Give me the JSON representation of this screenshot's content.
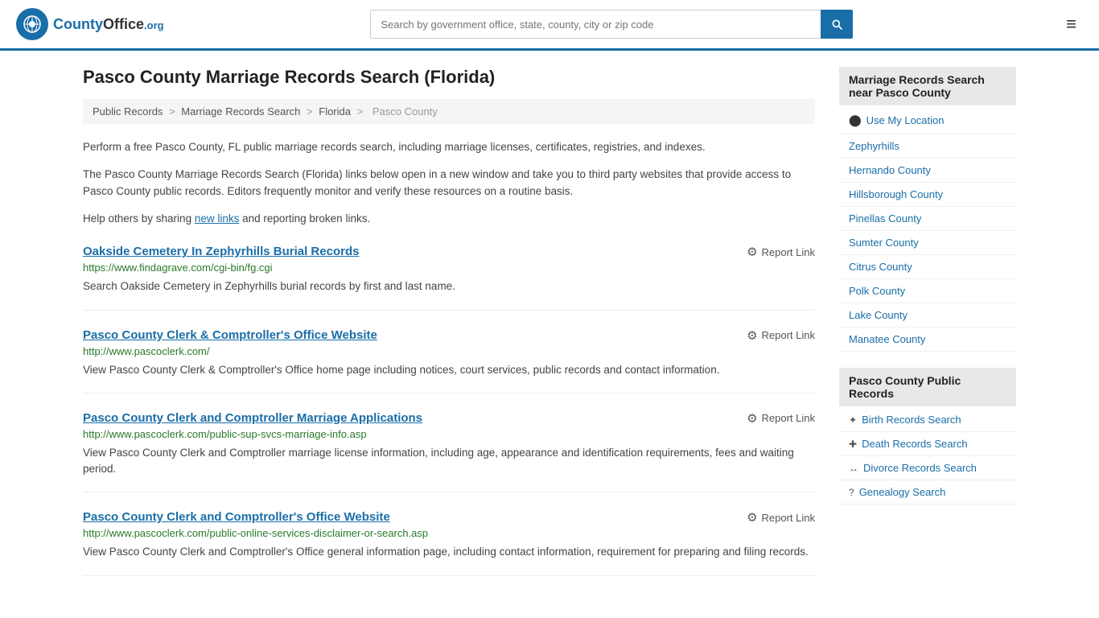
{
  "header": {
    "logo_text": "CountyOffice",
    "logo_org": ".org",
    "search_placeholder": "Search by government office, state, county, city or zip code",
    "search_value": ""
  },
  "page": {
    "title": "Pasco County Marriage Records Search (Florida)",
    "breadcrumb": {
      "items": [
        "Public Records",
        "Marriage Records Search",
        "Florida",
        "Pasco County"
      ]
    },
    "description1": "Perform a free Pasco County, FL public marriage records search, including marriage licenses, certificates, registries, and indexes.",
    "description2": "The Pasco County Marriage Records Search (Florida) links below open in a new window and take you to third party websites that provide access to Pasco County public records. Editors frequently monitor and verify these resources on a routine basis.",
    "description3_pre": "Help others by sharing ",
    "description3_link": "new links",
    "description3_post": " and reporting broken links."
  },
  "results": [
    {
      "title": "Oakside Cemetery In Zephyrhills Burial Records",
      "url": "https://www.findagrave.com/cgi-bin/fg.cgi",
      "desc": "Search Oakside Cemetery in Zephyrhills burial records by first and last name.",
      "report": "Report Link"
    },
    {
      "title": "Pasco County Clerk & Comptroller's Office Website",
      "url": "http://www.pascoclerk.com/",
      "desc": "View Pasco County Clerk & Comptroller's Office home page including notices, court services, public records and contact information.",
      "report": "Report Link"
    },
    {
      "title": "Pasco County Clerk and Comptroller Marriage Applications",
      "url": "http://www.pascoclerk.com/public-sup-svcs-marriage-info.asp",
      "desc": "View Pasco County Clerk and Comptroller marriage license information, including age, appearance and identification requirements, fees and waiting period.",
      "report": "Report Link"
    },
    {
      "title": "Pasco County Clerk and Comptroller's Office Website",
      "url": "http://www.pascoclerk.com/public-online-services-disclaimer-or-search.asp",
      "desc": "View Pasco County Clerk and Comptroller's Office general information page, including contact information, requirement for preparing and filing records.",
      "report": "Report Link"
    }
  ],
  "sidebar": {
    "nearby_title": "Marriage Records Search near Pasco County",
    "use_location": "Use My Location",
    "nearby_links": [
      "Zephyrhills",
      "Hernando County",
      "Hillsborough County",
      "Pinellas County",
      "Sumter County",
      "Citrus County",
      "Polk County",
      "Lake County",
      "Manatee County"
    ],
    "public_records_title": "Pasco County Public Records",
    "public_records_links": [
      {
        "label": "Birth Records Search",
        "icon": "✦"
      },
      {
        "label": "Death Records Search",
        "icon": "✚"
      },
      {
        "label": "Divorce Records Search",
        "icon": "↔"
      },
      {
        "label": "Genealogy Search",
        "icon": "?"
      }
    ]
  }
}
